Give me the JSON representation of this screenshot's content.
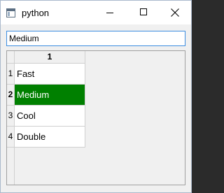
{
  "window": {
    "title": "python"
  },
  "search": {
    "value": "Medium"
  },
  "table": {
    "column_headers": [
      "1"
    ],
    "rows": [
      {
        "header": "1",
        "value": "Fast"
      },
      {
        "header": "2",
        "value": "Medium"
      },
      {
        "header": "3",
        "value": "Cool"
      },
      {
        "header": "4",
        "value": "Double"
      }
    ],
    "selected_row_index": 1,
    "selected_color": "#008000"
  },
  "icons": {
    "app": "app-window-icon",
    "minimize": "minimize-icon",
    "maximize": "maximize-icon",
    "close": "close-icon"
  }
}
